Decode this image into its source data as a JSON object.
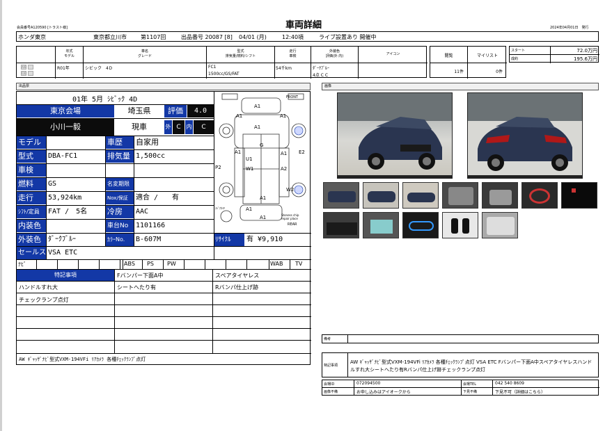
{
  "header": {
    "member_no": "会員番号A120590 [トラスト様]",
    "title": "車両詳細",
    "date": "2024年04月01日　発行"
  },
  "auction_bar": {
    "venue": "ホンダ東京",
    "location": "東京都立川市",
    "session": "第1107回",
    "lot": "出品番号 20087 [8]",
    "date": "04/01 (月)",
    "time": "12:40頃",
    "live": "ライブ設置あり 開催中"
  },
  "spec_table": {
    "headers": {
      "year": "年式\nモデル",
      "name": "車名\nグレード",
      "type": "型式\n排気量/燃料/シフト",
      "mileage": "走行\n車検",
      "color": "外装色\n評価(外 内)",
      "icon": "アイコン",
      "bids": "閲覧",
      "mylist": "マイリスト"
    },
    "year": "R01年",
    "name": "シビック　4Ｄ",
    "model": "FC1",
    "displacement": "1500cc/GS/FAT",
    "mileage": "54千km",
    "color": "ﾀﾞｰｸﾌﾞﾙｰ",
    "rating": "4点 C C",
    "views": "11件",
    "mylist": "0件",
    "start_label": "スタート",
    "start_price": "72.0万円",
    "result_label": "成約",
    "result_price": "195.6万円",
    "icon_labels": [
      "A/B",
      "C/D"
    ]
  },
  "sections": {
    "exhibit_sheet": "出品票",
    "images": "画像",
    "notes": "備考"
  },
  "sheet": {
    "top": "01年 5月 ｼﾋﾞｯｸ 4D",
    "venue": "東京会場",
    "pref": "埼玉県",
    "hyoka_label": "評価",
    "hyoka_value": "4.0",
    "inspector": "小川一毅",
    "genkyo": "現車",
    "gai_label": "外",
    "gai_value": "C",
    "nai_label": "内",
    "nai_value": "C",
    "rows": [
      {
        "label": "モデル",
        "value": "",
        "label2": "車歴",
        "value2": "自家用"
      },
      {
        "label": "型式",
        "value": "DBA-FC1",
        "label2": "排気量",
        "value2": "1,500cc"
      },
      {
        "label": "車検",
        "value": "",
        "label2": "",
        "value2": ""
      },
      {
        "label": "燃料",
        "value": "GS",
        "label2": "名変期限",
        "value2": ""
      },
      {
        "label": "走行",
        "value": "53,924km",
        "label2": "Nox/保証",
        "value2": "適合 /　　有"
      },
      {
        "label": "ｼﾌﾄ/定員",
        "value": "FAT /　5名",
        "label2": "冷房",
        "value2": "AAC"
      },
      {
        "label": "内装色",
        "value": "",
        "label2": "車台No",
        "value2": "1101166"
      },
      {
        "label": "外装色",
        "value": "ﾀﾞｰｸﾌﾞﾙｰ",
        "label2": "ｶﾗｰNo.",
        "value2": "B-607M"
      },
      {
        "label": "セールス",
        "value": "VSA ETC",
        "label2": "",
        "value2": ""
      }
    ],
    "recycle_label": "ﾘｻｲｸﾙ",
    "recycle_value": "有 ¥9,910",
    "equip": [
      "ﾅﾋﾞ",
      "",
      "",
      "",
      "",
      "",
      "ABS",
      "PS",
      "PW",
      "",
      "",
      "",
      "",
      "WAB",
      "TV"
    ],
    "tokki_header": "特記事項",
    "notes": [
      [
        "Fバンパー下面A中",
        "スペアタイヤレス"
      ],
      [
        "ハンドルすれ大",
        "シートへたり有",
        "Rバンパ仕上げ跡"
      ],
      [
        "チェックランプ点灯",
        "",
        ""
      ]
    ],
    "footer": "AW ｷﾞｬｯｻﾞﾅﾋﾞ型式VXM-194VFi ﾘｱｶﾒﾗ 各種ﾁｪｯｸﾗﾝﾌﾟ点灯",
    "diagram": {
      "front": "FRONT",
      "rear": "REAR",
      "spare": "ｽﾍﾟｱﾀｲﾔ",
      "legend": "Stoness chip\nrepair place",
      "marks": [
        "A1",
        "A1",
        "A1",
        "A1",
        "A1",
        "U1",
        "W1",
        "G",
        "E2",
        "A1",
        "A2",
        "P2",
        "W2",
        "A1",
        "A1",
        "A1"
      ]
    }
  },
  "right": {
    "notes_label": "備考",
    "tokki_label": "特記事項",
    "tokki_text": "AW ｷﾞｬｯｻﾞﾅﾋﾞ型式VXM-194VFi ﾘｱｶﾒﾗ 各種ﾁｪｯｸﾗﾝﾌﾟ点灯 VSA ETC Fバンパー下面A中スペアタイヤレスハンドルすれ大シートへたり有Rバンパ仕上げ跡チェックランプ点灯",
    "info": [
      {
        "label": "会場ID",
        "value": "072094500",
        "label2": "会場TEL",
        "value2": "042 540 8609"
      },
      {
        "label": "画像不備",
        "value": "お申し込みはアイオークから",
        "label2": "下見不備",
        "value2": "下見不可（詳細はこちら）"
      }
    ]
  },
  "colors": {
    "blue": "#1338a6",
    "black": "#0c0c0c",
    "car_body": "#2a3550"
  }
}
